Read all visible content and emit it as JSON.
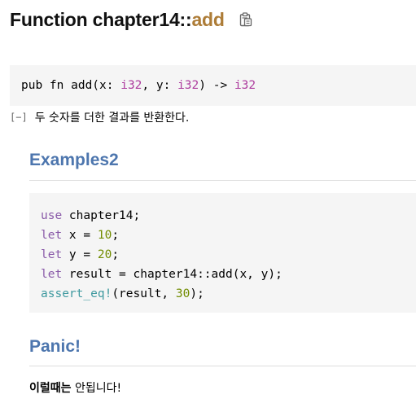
{
  "header": {
    "prefix": "Function chapter14::",
    "fn_name": "add",
    "copy_icon": "clipboard-icon"
  },
  "signature": {
    "p1": "pub fn add(x: ",
    "t1": "i32",
    "p2": ", y: ",
    "t2": "i32",
    "p3": ") -> ",
    "t3": "i32"
  },
  "docblock": {
    "toggle": "[−]",
    "summary": "두 숫자를 더한 결과를 반환한다."
  },
  "examples": {
    "heading": "Examples2",
    "code": {
      "l1_kw": "use",
      "l1_rest": " chapter14;",
      "l2_kw": "let",
      "l2_mid": " x = ",
      "l2_num": "10",
      "l2_end": ";",
      "l3_kw": "let",
      "l3_mid": " y = ",
      "l3_num": "20",
      "l3_end": ";",
      "l4_kw": "let",
      "l4_rest": " result = chapter14::add(x, y);",
      "l5_mac": "assert_eq!",
      "l5_mid": "(result, ",
      "l5_num": "30",
      "l5_end": ");"
    }
  },
  "panic": {
    "heading": "Panic!",
    "bold": "이럴때는",
    "rest": " 안됩니다!"
  },
  "colors": {
    "fn_name": "#ad7c37",
    "heading": "#4d76ae",
    "primitive": "#ad3c9e",
    "keyword": "#8959a8",
    "number": "#718c00",
    "macro": "#3e999f",
    "code_bg": "#f5f5f5"
  }
}
